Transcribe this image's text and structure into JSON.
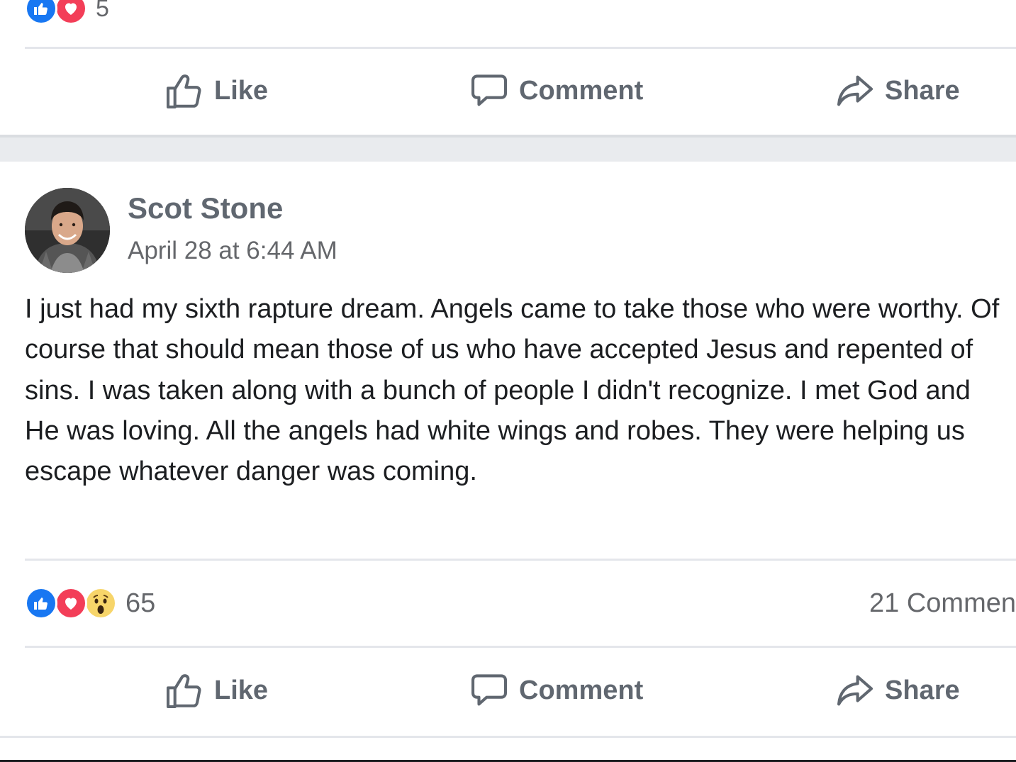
{
  "colors": {
    "like_blue": "#1877f2",
    "love_red": "#f33e58",
    "wow_yellow": "#f7d56a",
    "action_gray": "#606770",
    "text": "#1c1e21"
  },
  "previous_post": {
    "reaction_icons": [
      "like-icon",
      "love-icon"
    ],
    "reaction_count": "5",
    "actions": {
      "like": "Like",
      "comment": "Comment",
      "share": "Share"
    }
  },
  "post": {
    "author": "Scot Stone",
    "timestamp": "April 28 at 6:44 AM",
    "text": "I just had my sixth rapture dream. Angels came to take those who were worthy. Of course that should mean those of us who have accepted Jesus and repented of sins. I was taken along with a bunch of people I didn't recognize. I met God and He was loving. All the angels had white wings and robes. They were helping us escape whatever danger was coming.",
    "reaction_icons": [
      "like-icon",
      "love-icon",
      "wow-icon"
    ],
    "reaction_count": "65",
    "comments_count": "21 Commen",
    "actions": {
      "like": "Like",
      "comment": "Comment",
      "share": "Share"
    }
  }
}
